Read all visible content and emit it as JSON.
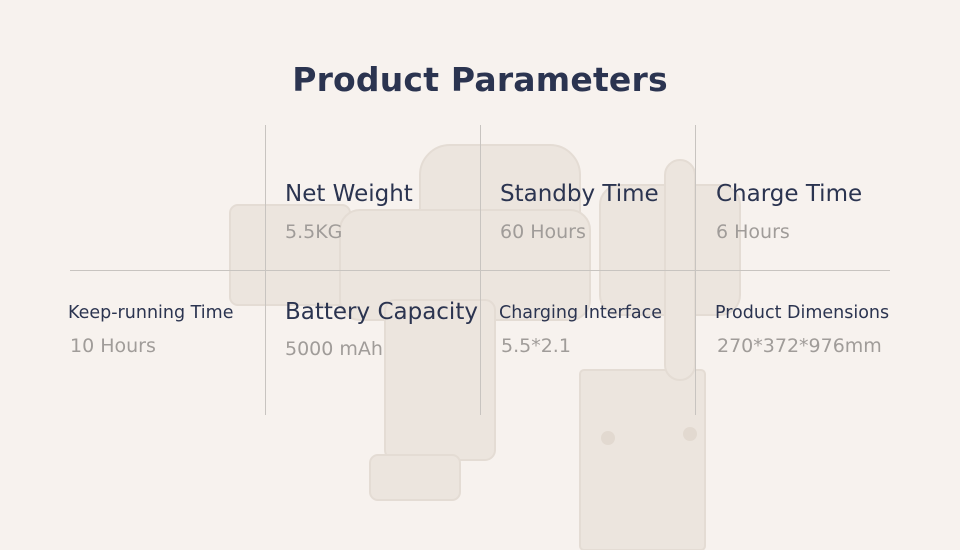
{
  "title": "Product Parameters",
  "params": [
    {
      "label": "Net Weight",
      "value": "5.5KG"
    },
    {
      "label": "Standby Time",
      "value": "60 Hours"
    },
    {
      "label": "Charge Time",
      "value": "6 Hours"
    },
    {
      "label": "Keep-running Time",
      "value": "10 Hours"
    },
    {
      "label": "Battery Capacity",
      "value": "5000 mAh"
    },
    {
      "label": "Charging Interface",
      "value": "5.5*2.1"
    },
    {
      "label": "Product Dimensions",
      "value": "270*372*976mm"
    }
  ]
}
